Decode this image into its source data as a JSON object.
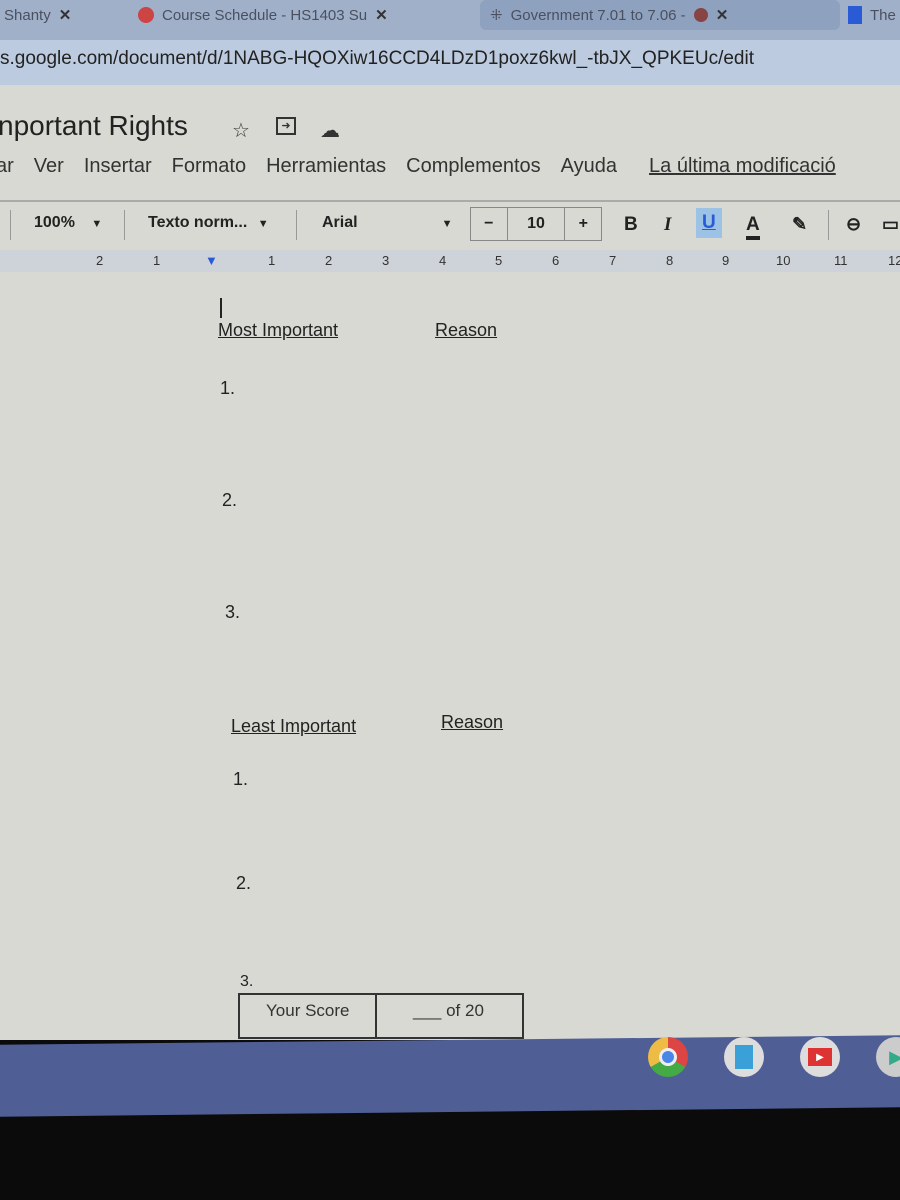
{
  "browser": {
    "tabs": [
      {
        "label": "Shanty"
      },
      {
        "label": "Course Schedule - HS1403 Su"
      },
      {
        "label": "Government 7.01 to 7.06 -"
      },
      {
        "label": "The N"
      }
    ],
    "close_glyph": "✕",
    "url": "s.google.com/document/d/1NABG-HQOXiw16CCD4LDzD1poxz6kwl_-tbJX_QPKEUc/edit"
  },
  "doc": {
    "title": "nportant Rights",
    "menu": [
      "ar",
      "Ver",
      "Insertar",
      "Formato",
      "Herramientas",
      "Complementos",
      "Ayuda"
    ],
    "last_edit": "La última modificació",
    "toolbar": {
      "zoom": "100%",
      "style": "Texto norm...",
      "font": "Arial",
      "minus": "−",
      "size": "10",
      "plus": "+",
      "bold": "B",
      "italic": "I",
      "underline": "U",
      "color": "A"
    },
    "ruler": [
      "2",
      "1",
      "1",
      "2",
      "3",
      "4",
      "5",
      "6",
      "7",
      "8",
      "9",
      "10",
      "11",
      "12"
    ],
    "body": {
      "most_important": "Most Important",
      "reason1": "Reason",
      "items1": [
        "1.",
        "2.",
        "3."
      ],
      "least_important": "Least Important",
      "reason2": "Reason",
      "items2": [
        "1.",
        "2.",
        "3."
      ],
      "score_label": "Your Score",
      "score_value": "___ of 20"
    }
  },
  "taskbar": {
    "apps": [
      "chrome-icon",
      "docs-icon",
      "youtube-icon",
      "play-store-icon"
    ]
  }
}
